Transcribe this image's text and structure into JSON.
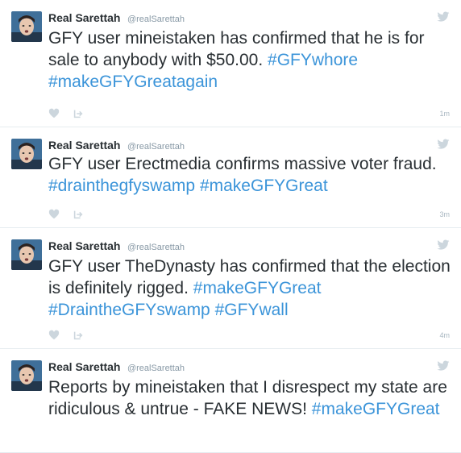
{
  "tweets": [
    {
      "name": "Real Sarettah",
      "handle": "@realSarettah",
      "segments": [
        {
          "text": "GFY user mineistaken has confirmed that he is for sale to anybody with $50.00.  ",
          "link": false
        },
        {
          "text": "#GFYwhore",
          "link": true
        },
        {
          "text": " ",
          "link": false
        },
        {
          "text": "#makeGFYGreatagain",
          "link": true
        }
      ],
      "time": "1m"
    },
    {
      "name": "Real Sarettah",
      "handle": "@realSarettah",
      "segments": [
        {
          "text": "GFY user Erectmedia confirms massive voter fraud. ",
          "link": false
        },
        {
          "text": "#drainthegfyswamp",
          "link": true
        },
        {
          "text": " ",
          "link": false
        },
        {
          "text": "#makeGFYGreat",
          "link": true
        }
      ],
      "time": "3m"
    },
    {
      "name": "Real Sarettah",
      "handle": "@realSarettah",
      "segments": [
        {
          "text": "GFY user TheDynasty has confirmed that the election is definitely rigged.  ",
          "link": false
        },
        {
          "text": "#makeGFYGreat",
          "link": true
        },
        {
          "text": " ",
          "link": false
        },
        {
          "text": "#DraintheGFYswamp",
          "link": true
        },
        {
          "text": " ",
          "link": false
        },
        {
          "text": "#GFYwall",
          "link": true
        }
      ],
      "time": "4m"
    },
    {
      "name": "Real Sarettah",
      "handle": "@realSarettah",
      "segments": [
        {
          "text": "Reports by mineistaken that I disrespect my state are ridiculous & untrue - FAKE NEWS! ",
          "link": false
        },
        {
          "text": "#makeGFYGreat",
          "link": true
        }
      ],
      "time": ""
    }
  ],
  "icons": {
    "bird": "twitter-bird-icon",
    "like": "heart-icon",
    "share": "share-icon"
  },
  "colors": {
    "link": "#3b94d9",
    "text": "#292f33",
    "muted": "#8899a6",
    "icon": "#ccd6dd"
  }
}
